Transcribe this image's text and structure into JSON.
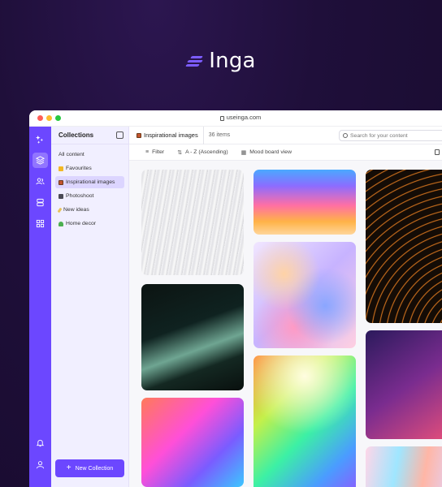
{
  "brand": {
    "name": "Inga",
    "logo_icon": "stripes-logo-icon"
  },
  "browser": {
    "url": "useinga.com",
    "dot_colors": [
      "#ff5f57",
      "#febc2e",
      "#28c840"
    ]
  },
  "colors": {
    "accent": "#6c47ff",
    "sidebar_bg": "#f1efff",
    "active_item": "#dcd5ff"
  },
  "rail": {
    "icons": [
      "sparkles-icon",
      "layers-icon",
      "users-icon",
      "database-icon",
      "grid-icon",
      "bell-icon",
      "user-icon"
    ]
  },
  "sidebar": {
    "title": "Collections",
    "items": [
      {
        "label": "All content",
        "icon": ""
      },
      {
        "label": "Favourites",
        "icon": "crown-icon"
      },
      {
        "label": "Inspirational images",
        "icon": "picture-icon",
        "active": true
      },
      {
        "label": "Photoshoot",
        "icon": "camera-icon"
      },
      {
        "label": "New ideas",
        "icon": "pencil-icon"
      },
      {
        "label": "Home decor",
        "icon": "plant-icon"
      }
    ],
    "new_button": "New Collection"
  },
  "main": {
    "crumb_icon": "picture-icon",
    "title": "Inspirational images",
    "count": "36 items",
    "search_placeholder": "Search for your content",
    "toolbar": {
      "filter": "Filter",
      "sort": "A - Z (Ascending)",
      "view": "Mood board view"
    }
  },
  "gallery": {
    "images": [
      "white-waves-image",
      "iridescent-gradient-image",
      "orange-lines-image",
      "marble-swirl-image",
      "dark-green-fold-image",
      "rainbow-gradient-image",
      "purple-gradient-image",
      "neon-shapes-image",
      "pastel-marble-image"
    ]
  }
}
